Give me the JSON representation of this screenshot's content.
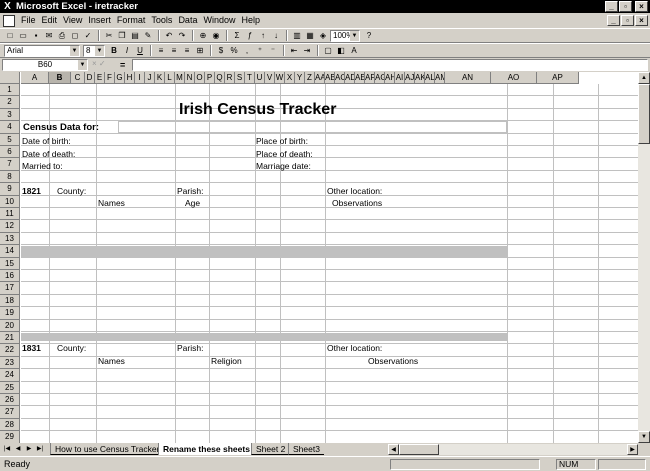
{
  "window": {
    "title": "Microsoft Excel - iretracker"
  },
  "menu": [
    "File",
    "Edit",
    "View",
    "Insert",
    "Format",
    "Tools",
    "Data",
    "Window",
    "Help"
  ],
  "format_toolbar": {
    "font": "Arial",
    "size": "8",
    "zoom": "100%"
  },
  "formula_bar": {
    "cell_ref": "B60",
    "value": ""
  },
  "columns": [
    "A",
    "B",
    "C",
    "D",
    "E",
    "F",
    "G",
    "H",
    "I",
    "J",
    "K",
    "L",
    "M",
    "N",
    "O",
    "P",
    "Q",
    "R",
    "S",
    "T",
    "U",
    "V",
    "W",
    "X",
    "Y",
    "Z",
    "AA",
    "AB",
    "AC",
    "AD",
    "AE",
    "AF",
    "AG",
    "AH",
    "AI",
    "AJ",
    "AK",
    "AL",
    "AM",
    "AN",
    "AO",
    "AP"
  ],
  "rows": [
    "1",
    "2",
    "3",
    "4",
    "5",
    "6",
    "7",
    "8",
    "9",
    "10",
    "11",
    "12",
    "13",
    "14",
    "15",
    "16",
    "17",
    "18",
    "19",
    "20",
    "21",
    "22",
    "23",
    "24",
    "25",
    "26",
    "27",
    "28",
    "29"
  ],
  "sheet": {
    "title": "Irish Census Tracker",
    "census_data_for": "Census Data for:",
    "date_of_birth": "Date of birth:",
    "place_of_birth": "Place of birth:",
    "date_of_death": "Date of death:",
    "place_of_death": "Place of death:",
    "married_to": "Married to:",
    "marriage_date": "Marriage date:",
    "s1821": {
      "year": "1821",
      "county": "County:",
      "parish": "Parish:",
      "other_location": "Other location:",
      "col_names": "Names",
      "col_age": "Age",
      "col_observations": "Observations"
    },
    "s1831": {
      "year": "1831",
      "county": "County:",
      "parish": "Parish:",
      "other_location": "Other location:",
      "col_names": "Names",
      "col_religion": "Religion",
      "col_observations": "Observations"
    }
  },
  "tabs": [
    "How to use Census Tracker",
    "Rename these sheets",
    "Sheet 2",
    "Sheet3"
  ],
  "active_tab": "Rename these sheets",
  "status": {
    "text": "Ready",
    "num": "NUM"
  }
}
